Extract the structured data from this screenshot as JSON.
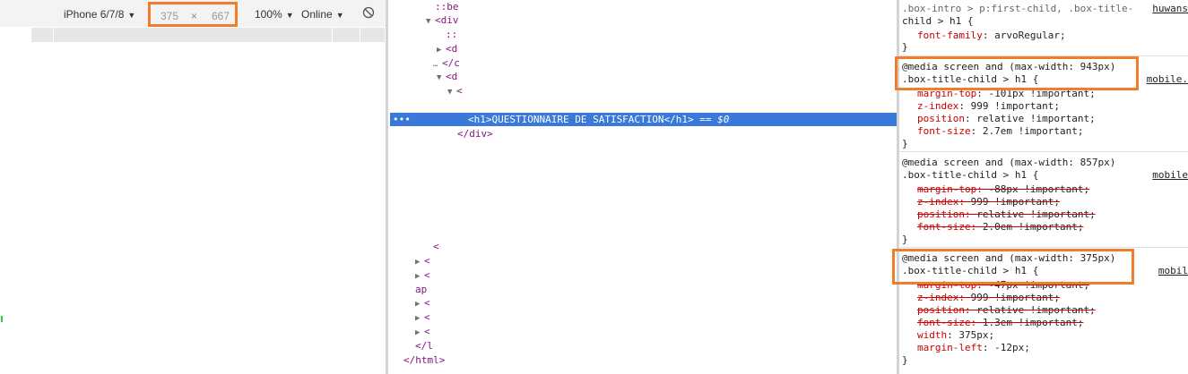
{
  "toolbar": {
    "device": "iPhone 6/7/8",
    "width": "375",
    "separator": "×",
    "height": "667",
    "zoom": "100%",
    "network": "Online",
    "dropdown_glyph": "▼"
  },
  "elements": {
    "lines": [
      {
        "tri": "",
        "text": "::be"
      },
      {
        "tri": "▼",
        "text": "<div"
      },
      {
        "tri": "",
        "text": "::"
      },
      {
        "tri": "▶",
        "text": "<d"
      },
      {
        "tri": "…",
        "text": "</c"
      },
      {
        "tri": "▼",
        "text": "<d"
      },
      {
        "tri": "▼",
        "text": "<"
      }
    ],
    "selected": {
      "dots": "•••",
      "text": "<h1>QUESTIONNAIRE DE SATISFACTION</h1>",
      "suffix": " == $0"
    },
    "after_selected": "</div>",
    "lower_lines": [
      {
        "tri": "",
        "text": "<"
      },
      {
        "tri": "▶",
        "text": "<"
      },
      {
        "tri": "▶",
        "text": "<"
      },
      {
        "tri": "",
        "text": "ap"
      },
      {
        "tri": "▶",
        "text": "<"
      },
      {
        "tri": "▶",
        "text": "<"
      },
      {
        "tri": "▶",
        "text": "<"
      },
      {
        "tri": "",
        "text": "</l"
      },
      {
        "tri": "",
        "text": "</html>"
      }
    ]
  },
  "styles": {
    "rule0": {
      "selector_a": ".box-intro > p:first-child, .box-title-",
      "source": "huwans",
      "selector_b": "child > h1 {",
      "props": [
        {
          "name": "font-family",
          "value": "arvoRegular;"
        }
      ],
      "close": "}"
    },
    "rule1": {
      "media": "@media screen and (max-width: 943px)",
      "selector": ".box-title-child > h1 {",
      "source": "mobile.",
      "props": [
        {
          "name": "margin-top",
          "value": "-101px !important;"
        },
        {
          "name": "z-index",
          "value": "999 !important;"
        },
        {
          "name": "position",
          "value": "relative !important;"
        },
        {
          "name": "font-size",
          "value": "2.7em !important;"
        }
      ],
      "close": "}"
    },
    "rule2": {
      "media": "@media screen and (max-width: 857px)",
      "selector": ".box-title-child > h1 {",
      "source": "mobile",
      "props": [
        {
          "name": "margin-top",
          "value": "-88px !important;"
        },
        {
          "name": "z-index",
          "value": "999 !important;"
        },
        {
          "name": "position",
          "value": "relative !important;"
        },
        {
          "name": "font-size",
          "value": "2.0em !important;"
        }
      ],
      "close": "}"
    },
    "rule3": {
      "media": "@media screen and (max-width: 375px)",
      "selector": ".box-title-child > h1 {",
      "source": "mobil",
      "props": [
        {
          "name": "margin-top",
          "value": "-47px !important;"
        },
        {
          "name": "z-index",
          "value": "999 !important;"
        },
        {
          "name": "position",
          "value": "relative !important;"
        },
        {
          "name": "font-size",
          "value": "1.3em !important;"
        },
        {
          "name": "width",
          "value": "375px;"
        },
        {
          "name": "margin-left",
          "value": "-12px;"
        }
      ],
      "close": "}"
    }
  },
  "colors": {
    "highlight": "#f07d2a",
    "selection": "#3879d9",
    "tag": "#881280",
    "property": "#c80000"
  }
}
